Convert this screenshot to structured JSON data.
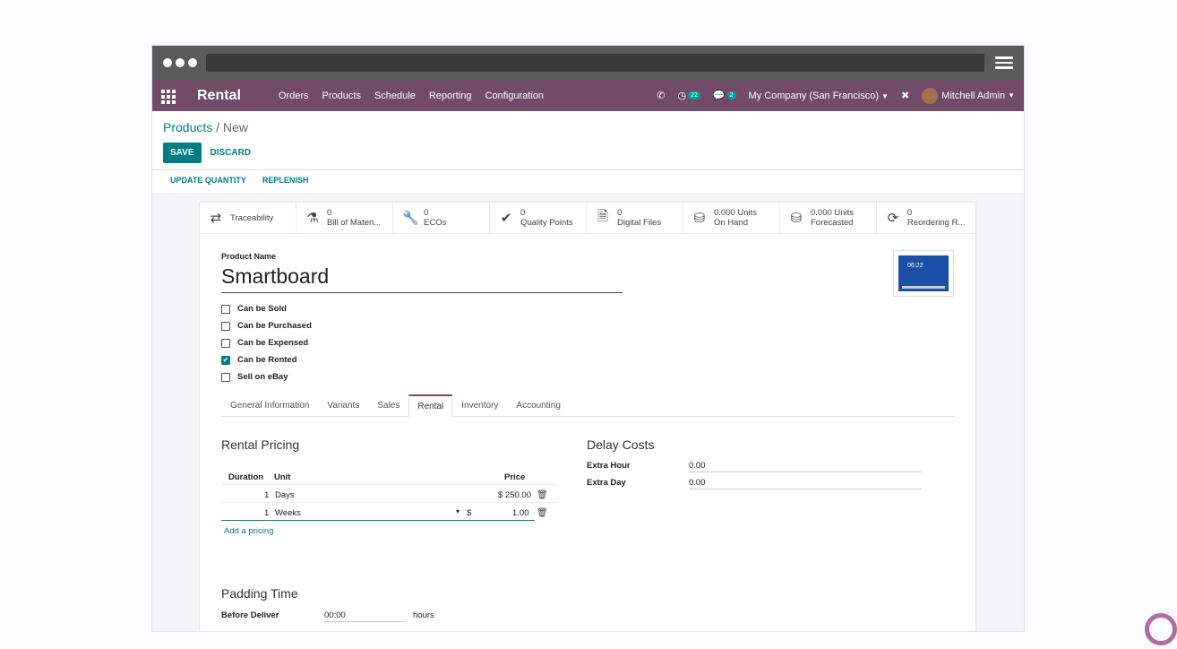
{
  "navbar": {
    "app_name": "Rental",
    "menu": [
      "Orders",
      "Products",
      "Schedule",
      "Reporting",
      "Configuration"
    ],
    "activity_count": "22",
    "messages_count": "2",
    "company": "My Company (San Francisco)",
    "user": "Mitchell Admin"
  },
  "breadcrumb": {
    "parent": "Products",
    "current": "New"
  },
  "buttons": {
    "save": "SAVE",
    "discard": "DISCARD"
  },
  "statusbar": {
    "update_quantity": "UPDATE QUANTITY",
    "replenish": "REPLENISH"
  },
  "smart_buttons": [
    {
      "icon": "arrows-swap-icon",
      "glyph": "⇄",
      "line1": "",
      "line2": "Traceability"
    },
    {
      "icon": "flask-icon",
      "glyph": "⚗",
      "line1": "0",
      "line2": "Bill of Materi..."
    },
    {
      "icon": "wrench-icon",
      "glyph": "🔧",
      "line1": "0",
      "line2": "ECOs"
    },
    {
      "icon": "check-icon",
      "glyph": "✔",
      "line1": "0",
      "line2": "Quality Points"
    },
    {
      "icon": "file-icon",
      "glyph": "🗎",
      "line1": "0",
      "line2": "Digital Files"
    },
    {
      "icon": "cubes-icon",
      "glyph": "⛁",
      "line1": "0.000 Units",
      "line2": "On Hand"
    },
    {
      "icon": "cubes-icon",
      "glyph": "⛁",
      "line1": "0.000 Units",
      "line2": "Forecasted"
    },
    {
      "icon": "refresh-icon",
      "glyph": "⟳",
      "line1": "0",
      "line2": "Reordering R..."
    }
  ],
  "product": {
    "name_label": "Product Name",
    "name": "Smartboard",
    "image_text": "06:22"
  },
  "checkboxes": [
    {
      "label": "Can be Sold",
      "checked": false
    },
    {
      "label": "Can be Purchased",
      "checked": false
    },
    {
      "label": "Can be Expensed",
      "checked": false
    },
    {
      "label": "Can be Rented",
      "checked": true
    },
    {
      "label": "Sell on eBay",
      "checked": false
    }
  ],
  "tabs": [
    "General Information",
    "Variants",
    "Sales",
    "Rental",
    "Inventory",
    "Accounting"
  ],
  "active_tab": "Rental",
  "rental_pricing": {
    "title": "Rental Pricing",
    "headers": {
      "duration": "Duration",
      "unit": "Unit",
      "price": "Price"
    },
    "rows": [
      {
        "duration": "1",
        "unit": "Days",
        "price": "$ 250.00"
      },
      {
        "duration": "1",
        "unit": "Weeks",
        "currency": "$",
        "price": "1.00"
      }
    ],
    "add_link": "Add a pricing"
  },
  "delay_costs": {
    "title": "Delay Costs",
    "extra_hour_label": "Extra Hour",
    "extra_hour": "0.00",
    "extra_day_label": "Extra Day",
    "extra_day": "0.00"
  },
  "padding_time": {
    "title": "Padding Time",
    "before_label": "Before Deliver",
    "before_value": "00:00",
    "unit": "hours"
  },
  "colors": {
    "brand": "#714b67",
    "accent": "#017e84"
  }
}
